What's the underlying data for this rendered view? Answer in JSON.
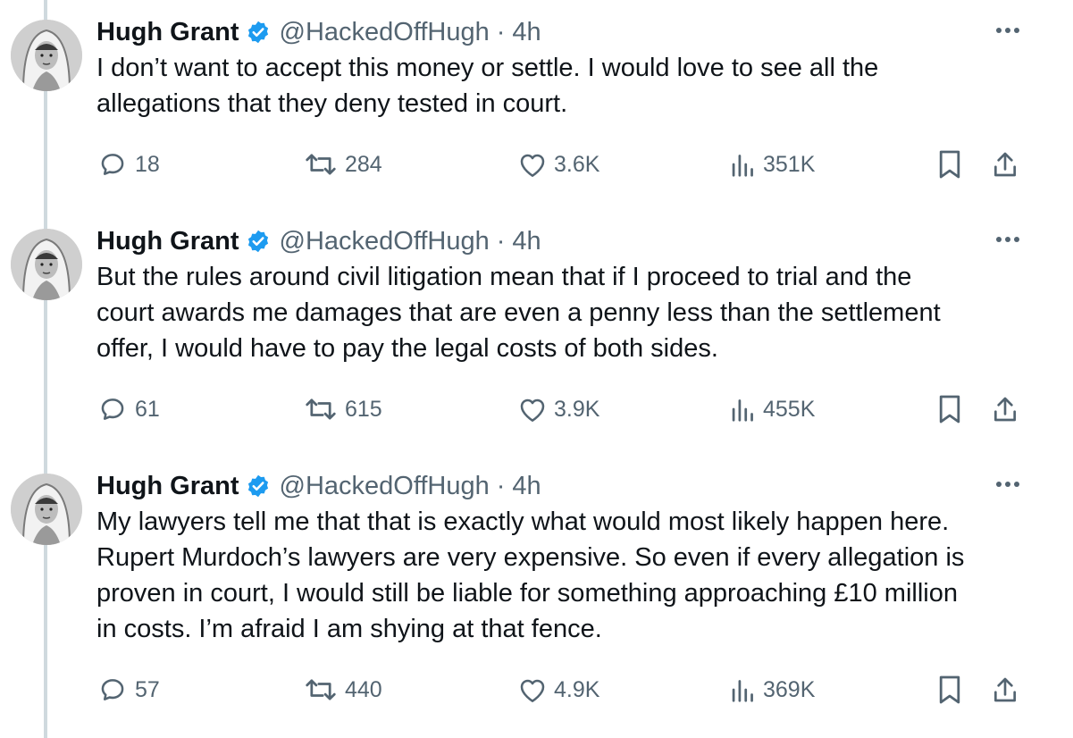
{
  "tweets": [
    {
      "author": "Hugh Grant",
      "handle": "@HackedOffHugh",
      "separator": "·",
      "time": "4h",
      "text": "I don’t want to accept this money or settle. I would love to see all the\nallegations that they deny tested in court.",
      "replies": "18",
      "reposts": "284",
      "likes": "3.6K",
      "views": "351K"
    },
    {
      "author": "Hugh Grant",
      "handle": "@HackedOffHugh",
      "separator": "·",
      "time": "4h",
      "text": "But the rules around civil litigation mean that if I proceed to trial and the\ncourt  awards me damages that are even a penny less than the settlement\noffer, I would have to pay the legal costs of both sides.",
      "replies": "61",
      "reposts": "615",
      "likes": "3.9K",
      "views": "455K"
    },
    {
      "author": "Hugh Grant",
      "handle": "@HackedOffHugh",
      "separator": "·",
      "time": "4h",
      "text": "My lawyers tell me that that is exactly what would most likely happen here.\nRupert Murdoch’s lawyers are very expensive. So even if every allegation is\nproven in court, I would still be liable for something approaching £10 million\nin costs. I’m afraid I am shying at that fence.",
      "replies": "57",
      "reposts": "440",
      "likes": "4.9K",
      "views": "369K"
    }
  ],
  "icons": {
    "verified": "verified-badge-icon",
    "more": "more-options-icon",
    "reply": "reply-icon",
    "repost": "repost-icon",
    "like": "like-icon",
    "views": "views-icon",
    "bookmark": "bookmark-icon",
    "share": "share-icon"
  },
  "colors": {
    "text": "#0f1419",
    "secondary": "#536471",
    "verified": "#1d9bf0",
    "thread_line": "#cfd9de"
  }
}
